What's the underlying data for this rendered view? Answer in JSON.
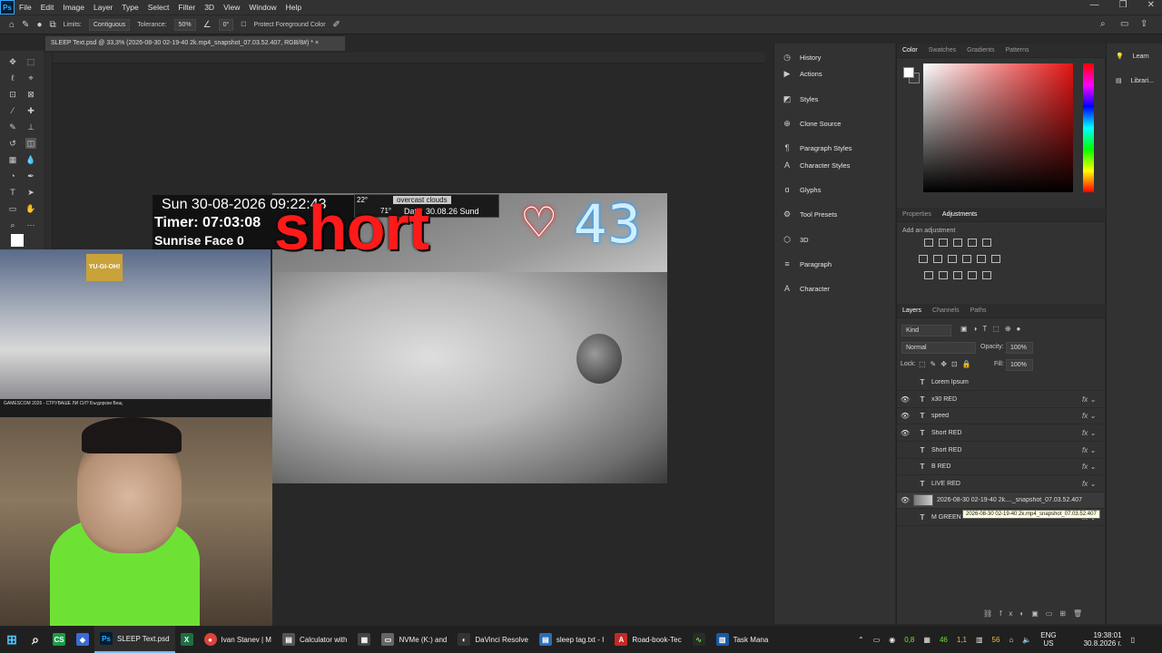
{
  "menubar": {
    "logo": "Ps",
    "items": [
      "File",
      "Edit",
      "Image",
      "Layer",
      "Type",
      "Select",
      "Filter",
      "3D",
      "View",
      "Window",
      "Help"
    ]
  },
  "options": {
    "limits_label": "Limits:",
    "limits_value": "Contiguous",
    "tolerance_label": "Tolerance:",
    "tolerance_value": "50%",
    "angle_value": "0°",
    "protect_label": "Protect Foreground Color"
  },
  "document": {
    "tab_title": "SLEEP Text.psd @ 33,3% (2026-08-30 02-19-40 2k.mp4_snapshot_07.03.52.407, RGB/8#) *"
  },
  "canvas": {
    "date_line": "Sun 30-08-2026 09:22:43",
    "timer_line": "Timer: 07:03:08",
    "third_line": "Sunrise Face 0",
    "weather_temp1": "22°",
    "weather_desc": "overcast clouds",
    "weather_temp2": "71°",
    "weather_date": "Date: 30.08.26 Sund",
    "big_word": "short",
    "heart": "♡",
    "count": "43"
  },
  "webcam_top": {
    "banner": "YU-GI-OH!",
    "caption": "GAMESCOM 2026 - СТРУВАШЕ ЛИ СИ? Бъгдорски Вещ"
  },
  "panel_mid": {
    "items": [
      {
        "label": "History",
        "icon": "history-icon"
      },
      {
        "label": "Actions",
        "icon": "actions-icon"
      },
      {
        "label": "Styles",
        "icon": "styles-icon"
      },
      {
        "label": "Clone Source",
        "icon": "clone-source-icon"
      },
      {
        "label": "Paragraph Styles",
        "icon": "paragraph-styles-icon"
      },
      {
        "label": "Character Styles",
        "icon": "character-styles-icon"
      },
      {
        "label": "Glyphs",
        "icon": "glyphs-icon"
      },
      {
        "label": "Tool Presets",
        "icon": "tool-presets-icon"
      },
      {
        "label": "3D",
        "icon": "3d-icon"
      },
      {
        "label": "Paragraph",
        "icon": "paragraph-icon"
      },
      {
        "label": "Character",
        "icon": "character-icon"
      }
    ]
  },
  "color_panel": {
    "tabs": [
      "Color",
      "Swatches",
      "Gradients",
      "Patterns"
    ]
  },
  "adjust_panel": {
    "tabs": [
      "Properties",
      "Adjustments"
    ],
    "add_label": "Add an adjustment"
  },
  "layers_panel": {
    "tabs": [
      "Layers",
      "Channels",
      "Paths"
    ],
    "filter_kind": "Kind",
    "blend_mode": "Normal",
    "opacity_label": "Opacity:",
    "opacity_value": "100%",
    "lock_label": "Lock:",
    "fill_label": "Fill:",
    "fill_value": "100%",
    "layers": [
      {
        "name": "Lorem Ipsum",
        "visible": false,
        "fx": false
      },
      {
        "name": "x30 RED",
        "visible": true,
        "fx": true
      },
      {
        "name": "speed",
        "visible": true,
        "fx": true
      },
      {
        "name": "Short RED",
        "visible": true,
        "fx": true
      },
      {
        "name": "Short RED",
        "visible": false,
        "fx": true
      },
      {
        "name": "B RED",
        "visible": false,
        "fx": true
      },
      {
        "name": "LIVE RED",
        "visible": false,
        "fx": true
      },
      {
        "name": "2026-08-30 02-19-40 2k...._snapshot_07.03.52.407",
        "visible": true,
        "fx": false,
        "image": true
      },
      {
        "name": "M GREEN",
        "visible": false,
        "fx": true
      }
    ],
    "tooltip": "2026-08-30 02-19-40 2k.mp4_snapshot_07.03.52.407"
  },
  "learn_panel": {
    "items": [
      "Learn",
      "Librari..."
    ]
  },
  "taskbar": {
    "items": [
      {
        "label": "",
        "icon": "CS",
        "color": "#1c9b48"
      },
      {
        "label": "",
        "icon": "◆",
        "color": "#3b6ad6"
      },
      {
        "label": "SLEEP Text.psd",
        "icon": "Ps",
        "color": "#001e36",
        "active": true
      },
      {
        "label": "",
        "icon": "X",
        "color": "#1d6f42"
      },
      {
        "label": "Ivan Stanev | M",
        "icon": "●",
        "color": "#db4437"
      },
      {
        "label": "Calculator with",
        "icon": "▤",
        "color": "#555"
      },
      {
        "label": "",
        "icon": "▦",
        "color": "#444"
      },
      {
        "label": "NVMe (K:) and",
        "icon": "▭",
        "color": "#666"
      },
      {
        "label": "DaVinci Resolve",
        "icon": "◐",
        "color": "#333"
      },
      {
        "label": "sleep tag.txt - I",
        "icon": "▤",
        "color": "#2a6db5"
      },
      {
        "label": "Road-book-Tec",
        "icon": "A",
        "color": "#c62828"
      },
      {
        "label": "",
        "icon": "∿",
        "color": "#2b2b2b"
      },
      {
        "label": "Task Mana",
        "icon": "▥",
        "color": "#1a5aa0"
      }
    ],
    "tray": {
      "val1": "0,8",
      "val2": "46",
      "val3": "1,1",
      "val4": "56",
      "lang1": "ENG",
      "lang2": "US",
      "time": "19:38:01",
      "date": "30.8.2026 г."
    }
  }
}
